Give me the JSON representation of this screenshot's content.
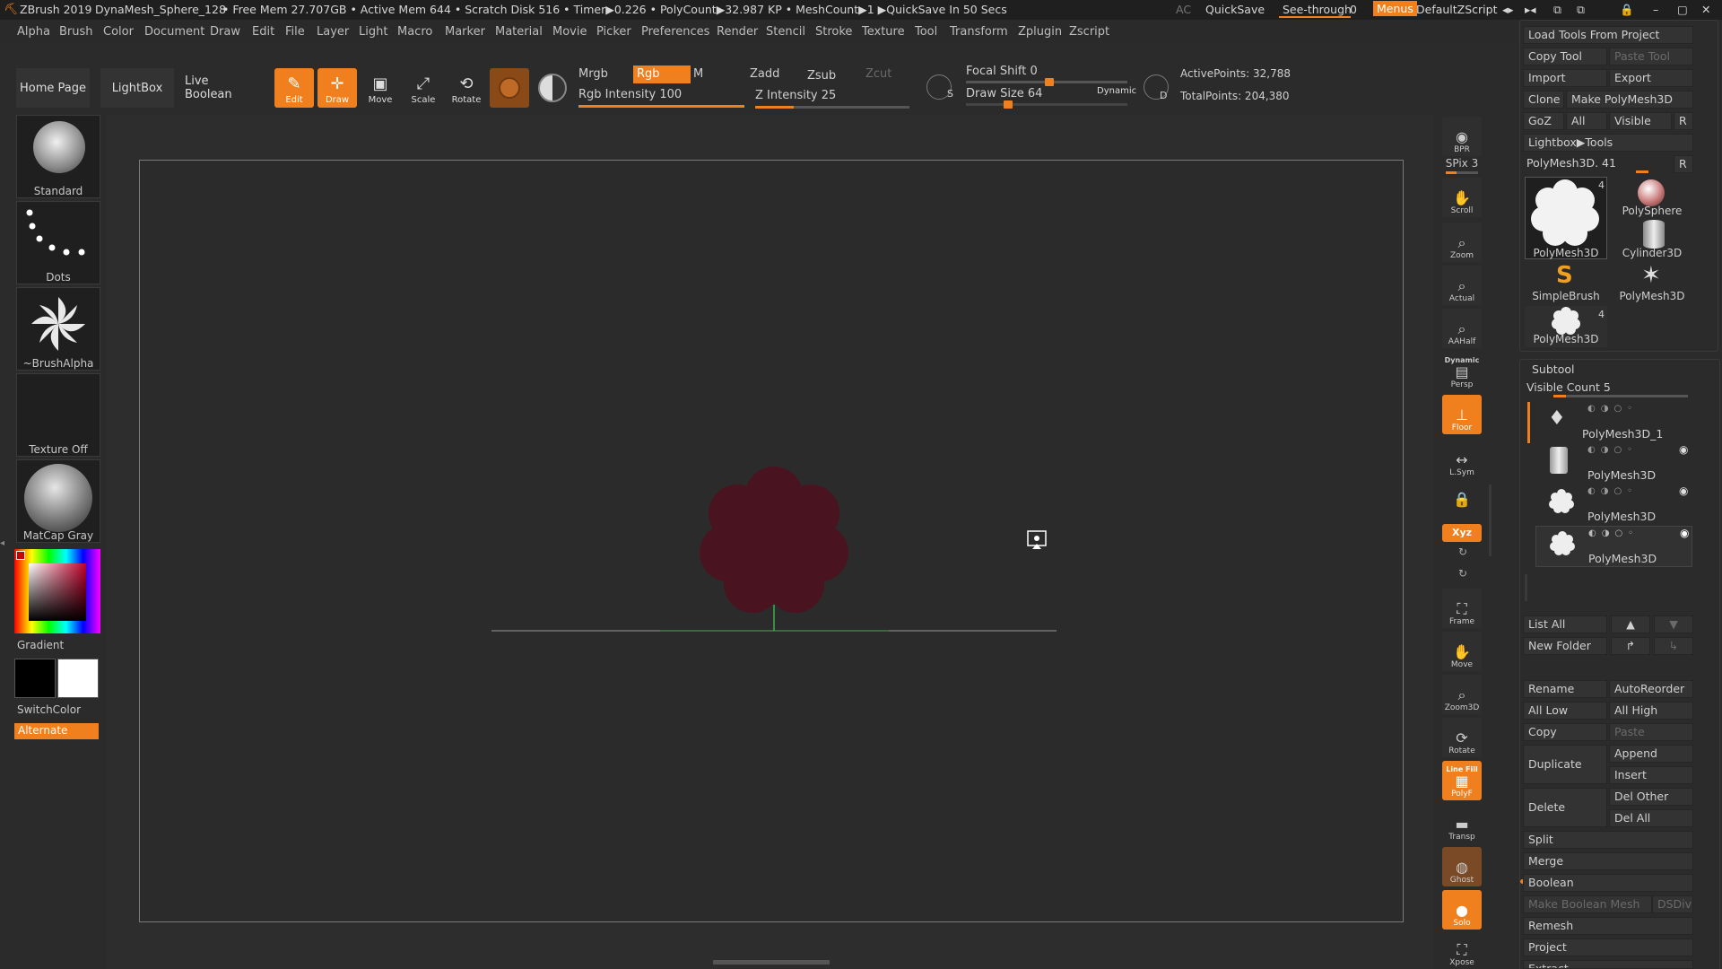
{
  "titlebar": {
    "app": "ZBrush 2019",
    "document": "DynaMesh_Sphere_128",
    "stats": "• Free Mem 27.707GB • Active Mem 644 • Scratch Disk 516 • Timer▶0.226 • PolyCount▶32.987 KP • MeshCount▶1 ▶QuickSave In 50 Secs",
    "ac": "AC",
    "quicksave": "QuickSave",
    "seethrough_label": "See-through",
    "seethrough_value": "0",
    "menus": "Menus",
    "script": "DefaultZScript"
  },
  "menubar": [
    "Alpha",
    "Brush",
    "Color",
    "Document",
    "Draw",
    "Edit",
    "File",
    "Layer",
    "Light",
    "Macro",
    "Marker",
    "Material",
    "Movie",
    "Picker",
    "Preferences",
    "Render",
    "Stencil",
    "Stroke",
    "Texture",
    "Tool",
    "Transform",
    "Zplugin",
    "Zscript"
  ],
  "shelf": {
    "home": "Home Page",
    "lightbox": "LightBox",
    "liveboolean": "Live Boolean",
    "edit": "Edit",
    "draw": "Draw",
    "move": "Move",
    "scale": "Scale",
    "rotate": "Rotate",
    "mrgb": "Mrgb",
    "rgb": "Rgb",
    "m": "M",
    "rgb_intensity": "Rgb Intensity 100",
    "rgb_intensity_value": 100,
    "zadd": "Zadd",
    "zsub": "Zsub",
    "zcut": "Zcut",
    "z_intensity": "Z Intensity 25",
    "z_intensity_value": 25,
    "focal_shift": "Focal Shift 0",
    "draw_size": "Draw Size 64",
    "dynamic": "Dynamic",
    "active_points": "ActivePoints: 32,788",
    "total_points": "TotalPoints: 204,380"
  },
  "left": {
    "brush": "Standard",
    "stroke": "Dots",
    "alpha": "~BrushAlpha",
    "texture": "Texture Off",
    "material": "MatCap Gray",
    "gradient": "Gradient",
    "switchcolor": "SwitchColor",
    "alternate": "Alternate"
  },
  "rtools": [
    "BPR",
    "SPix 3",
    "Scroll",
    "Zoom",
    "Actual",
    "AAHalf",
    "Persp",
    "Floor",
    "L.Sym",
    "Xyz",
    "Frame",
    "Move",
    "Zoom3D",
    "Rotate",
    "PolyF",
    "Transp",
    "Ghost",
    "Solo",
    "Xpose"
  ],
  "rtools_dynamic": "Dynamic",
  "rtools_linefill": "Line Fill",
  "rpanel": {
    "load_tools": "Load Tools From Project",
    "copy_tool": "Copy Tool",
    "paste_tool": "Paste Tool",
    "import": "Import",
    "export": "Export",
    "clone": "Clone",
    "make_polymesh": "Make PolyMesh3D",
    "goz": "GoZ",
    "all": "All",
    "visible": "Visible",
    "r": "R",
    "lightbox_tools": "Lightbox▶Tools",
    "current_tool": "PolyMesh3D. 41",
    "tools": [
      {
        "label": "PolyMesh3D",
        "count": "4"
      },
      {
        "label": "PolySphere",
        "count": ""
      },
      {
        "label": "Cylinder3D",
        "count": ""
      },
      {
        "label": "SimpleBrush",
        "count": ""
      },
      {
        "label": "PolyMesh3D",
        "count": ""
      },
      {
        "label": "PolyMesh3D",
        "count": "4"
      }
    ],
    "subtool": "Subtool",
    "visible_count": "Visible Count 5",
    "subtools": [
      "PolyMesh3D_1",
      "PolyMesh3D",
      "PolyMesh3D",
      "PolyMesh3D"
    ],
    "list_all": "List All",
    "new_folder": "New Folder",
    "rename": "Rename",
    "autoreorder": "AutoReorder",
    "all_low": "All Low",
    "all_high": "All High",
    "copy": "Copy",
    "paste": "Paste",
    "duplicate": "Duplicate",
    "append": "Append",
    "insert": "Insert",
    "delete": "Delete",
    "del_other": "Del Other",
    "del_all": "Del All",
    "split": "Split",
    "merge": "Merge",
    "boolean": "Boolean",
    "make_boolean_mesh": "Make Boolean Mesh",
    "dsdiv": "DSDiv",
    "remesh": "Remesh",
    "project": "Project",
    "extract": "Extract"
  },
  "colors": {
    "accent": "#f0801e",
    "mesh": "#4a1320",
    "floor_line": "#3fae49"
  }
}
